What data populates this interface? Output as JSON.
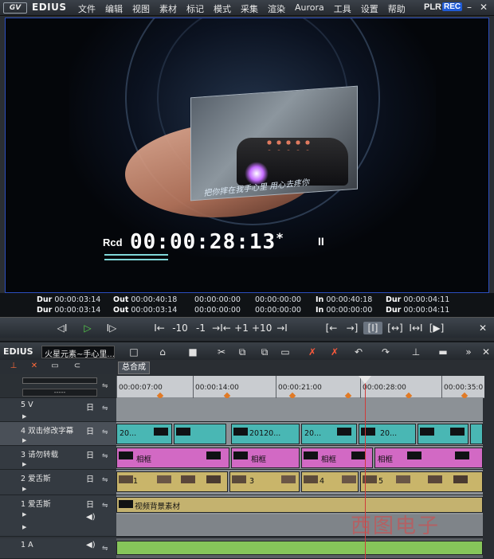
{
  "app": {
    "name": "EDIUS",
    "logo": "GV"
  },
  "menu": [
    "文件",
    "编辑",
    "视图",
    "素材",
    "标记",
    "模式",
    "采集",
    "渲染",
    "Aurora",
    "工具",
    "设置",
    "帮助"
  ],
  "mode": {
    "plr": "PLR",
    "rec": "REC"
  },
  "viewer": {
    "caption": "把你摔在我手心里 用心去疼你",
    "timecode_label": "Rcd",
    "timecode": "00:00:28:13",
    "timecode_suffix": "*",
    "pause_glyph": "II"
  },
  "info": {
    "row1": [
      {
        "label": "Dur",
        "value": "00:00:03:14"
      },
      {
        "label": "Out",
        "value": "00:00:40:18"
      },
      {
        "label": "",
        "value": "00:00:00:00"
      },
      {
        "label": "",
        "value": "00:00:00:00"
      },
      {
        "label": "In",
        "value": "00:00:40:18"
      },
      {
        "label": "Dur",
        "value": "00:00:04:11"
      }
    ],
    "row2": [
      {
        "label": "Dur",
        "value": "00:00:03:14"
      },
      {
        "label": "Out",
        "value": "00:00:03:14"
      },
      {
        "label": "",
        "value": "00:00:00:00"
      },
      {
        "label": "",
        "value": "00:00:00:00"
      },
      {
        "label": "In",
        "value": "00:00:00:00"
      },
      {
        "label": "Dur",
        "value": "00:00:04:11"
      }
    ]
  },
  "transport": {
    "prev": "◁I",
    "play": "▷",
    "next": "I▷",
    "jump_back": "I←",
    "minus10": "-10",
    "minus1": "-1",
    "step": "→I←",
    "plus1": "+1",
    "plus10": "+10",
    "jump_fwd": "→I",
    "mark_in": "[←",
    "mark_out": "→]",
    "center": "[I]",
    "split": "[↔]",
    "ripple": "I↔I",
    "close": "[▶]",
    "x": "✕"
  },
  "timeline": {
    "app_name": "EDIUS",
    "project": "火星元素~手心里...",
    "sequence_tab": "总合成",
    "ruler": [
      "00:00:07:00",
      "00:00:14:00",
      "00:00:21:00",
      "00:00:28:00",
      "00:00:35:0"
    ],
    "tracks": [
      {
        "num": "5 V",
        "type": "video"
      },
      {
        "num": "4 双击修改字幕",
        "type": "video"
      },
      {
        "num": "3 请勿转载",
        "type": "video"
      },
      {
        "num": "2 爱舌斯",
        "type": "video"
      },
      {
        "num": "1 爱舌斯",
        "type": "va"
      },
      {
        "num": "1 A",
        "type": "audio"
      }
    ],
    "clips": {
      "t4": [
        "20...",
        "20120...",
        "20...",
        "20..."
      ],
      "t3": [
        "相框",
        "相框",
        "相框",
        "相框"
      ],
      "t2": [
        "1",
        "3",
        "4",
        "5"
      ],
      "t1": [
        "视频背景素材"
      ]
    },
    "track_v_icon": "日",
    "watermark": "西图电子"
  }
}
